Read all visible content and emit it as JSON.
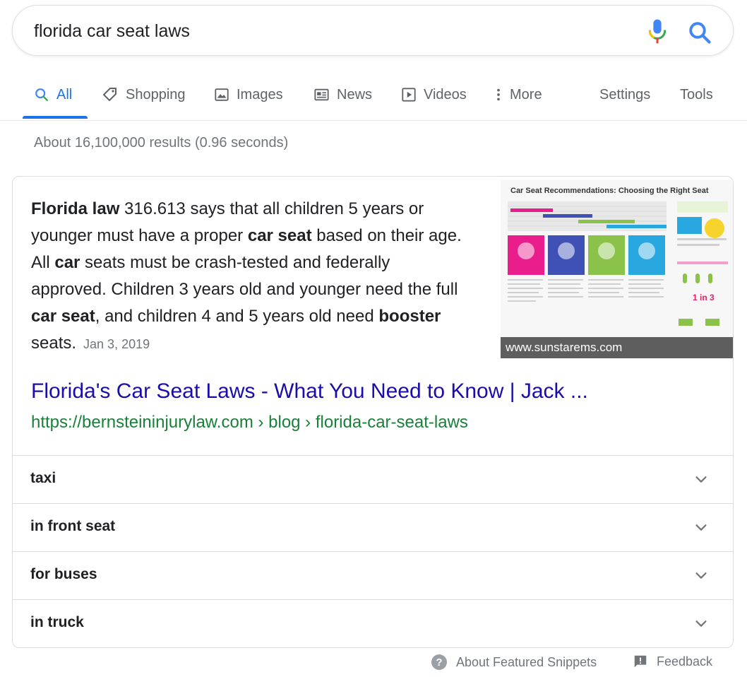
{
  "search": {
    "query": "florida car seat laws"
  },
  "tabs": [
    {
      "label": "All",
      "icon": "search-icon",
      "active": true
    },
    {
      "label": "Shopping",
      "icon": "tag-icon"
    },
    {
      "label": "Images",
      "icon": "image-icon"
    },
    {
      "label": "News",
      "icon": "news-icon"
    },
    {
      "label": "Videos",
      "icon": "play-icon"
    },
    {
      "label": "More",
      "icon": "more-vertical-icon"
    },
    {
      "label": "Settings"
    },
    {
      "label": "Tools"
    }
  ],
  "result_stats": "About 16,100,000 results (0.96 seconds)",
  "snippet": {
    "parts": [
      {
        "text": "Florida law",
        "bold": true
      },
      {
        "text": " 316.613 says that all children 5 years or younger must have a proper ",
        "bold": false
      },
      {
        "text": "car seat",
        "bold": true
      },
      {
        "text": " based on their age. All ",
        "bold": false
      },
      {
        "text": "car",
        "bold": true
      },
      {
        "text": " seats must be crash-tested and federally approved. Children 3 years old and younger need the full ",
        "bold": false
      },
      {
        "text": "car seat",
        "bold": true
      },
      {
        "text": ", and children 4 and 5 years old need ",
        "bold": false
      },
      {
        "text": "booster",
        "bold": true
      },
      {
        "text": " seats.",
        "bold": false
      }
    ],
    "date": "Jan 3, 2019",
    "image": {
      "title": "Car Seat Recommendations: Choosing the Right Seat",
      "caption": "www.sunstarems.com",
      "colors": [
        "#e91e8c",
        "#3f51b5",
        "#8bc34a",
        "#29a8e0"
      ]
    }
  },
  "result": {
    "title": "Florida's Car Seat Laws - What You Need to Know | Jack ...",
    "url": "https://bernsteininjurylaw.com › blog › florida-car-seat-laws"
  },
  "related": [
    "taxi",
    "in front seat",
    "for buses",
    "in truck"
  ],
  "footer": {
    "about": "About Featured Snippets",
    "feedback": "Feedback"
  },
  "colors": {
    "link": "#1a0dab",
    "url": "#188038",
    "accent": "#1a73e8"
  }
}
